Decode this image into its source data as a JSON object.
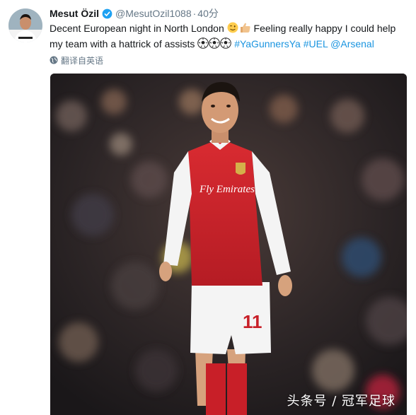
{
  "tweet": {
    "author": {
      "display_name": "Mesut Özil",
      "verified": true,
      "handle": "@MesutOzil1088",
      "time": "40分"
    },
    "text": {
      "part1": "Decent European night in North London ",
      "part2": " Feeling really happy I could help my team with a hattrick of assists ",
      "hashtag1": "#YaGunnersYa",
      "hashtag2": "#UEL",
      "mention": "@Arsenal"
    },
    "translate_label": "翻译自英语",
    "photo": {
      "shirt_sponsor": "Fly Emirates"
    },
    "watermark": "头条号 / 冠军足球"
  },
  "colors": {
    "link": "#1b95e0",
    "muted": "#657786",
    "verified": "#1da1f2",
    "arsenal_red": "#d1232a"
  },
  "icons": [
    "verified-badge-icon",
    "wink-emoji-icon",
    "thumbs-up-emoji-icon",
    "soccer-ball-emoji-icon",
    "globe-icon"
  ]
}
